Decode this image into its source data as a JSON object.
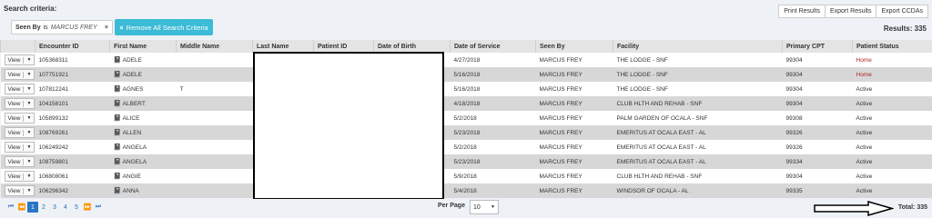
{
  "criteria": {
    "label": "Search criteria:",
    "chip": {
      "key": "Seen By",
      "op": "is",
      "value": "MARCUS FREY",
      "close": "×"
    },
    "remove_all": {
      "icon": "×",
      "label": "Remove All Search Criteria"
    }
  },
  "exports": [
    "Print Results",
    "Export Results",
    "Export CCDAs"
  ],
  "results": "Results: 335",
  "columns": [
    "",
    "Encounter ID",
    "First Name",
    "Middle Name",
    "Last Name",
    "Patient ID",
    "Date of Birth",
    "Date of Service",
    "Seen By",
    "Facility",
    "Primary CPT",
    "Patient Status"
  ],
  "view_label": "View",
  "rows": [
    {
      "id": "105368311",
      "first": "ADELE",
      "middle": "",
      "dos": "4/27/2018",
      "seen": "MARCUS FREY",
      "facility": "THE LODGE - SNF",
      "cpt": "99304",
      "status": "Home"
    },
    {
      "id": "107751921",
      "first": "ADELE",
      "middle": "",
      "dos": "5/16/2018",
      "seen": "MARCUS FREY",
      "facility": "THE LODGE - SNF",
      "cpt": "99304",
      "status": "Home"
    },
    {
      "id": "107812241",
      "first": "AGNES",
      "middle": "T",
      "dos": "5/16/2018",
      "seen": "MARCUS FREY",
      "facility": "THE LODGE - SNF",
      "cpt": "99304",
      "status": "Active"
    },
    {
      "id": "104158101",
      "first": "ALBERT",
      "middle": "",
      "dos": "4/18/2018",
      "seen": "MARCUS FREY",
      "facility": "CLUB HLTH AND REHAB - SNF",
      "cpt": "99304",
      "status": "Active"
    },
    {
      "id": "105899132",
      "first": "ALICE",
      "middle": "",
      "dos": "5/2/2018",
      "seen": "MARCUS FREY",
      "facility": "PALM GARDEN OF OCALA - SNF",
      "cpt": "99308",
      "status": "Active"
    },
    {
      "id": "108769261",
      "first": "ALLEN",
      "middle": "",
      "dos": "5/23/2018",
      "seen": "MARCUS FREY",
      "facility": "EMERITUS AT OCALA EAST - AL",
      "cpt": "99326",
      "status": "Active"
    },
    {
      "id": "106249242",
      "first": "ANGELA",
      "middle": "",
      "dos": "5/2/2018",
      "seen": "MARCUS FREY",
      "facility": "EMERITUS AT OCALA EAST - AL",
      "cpt": "99326",
      "status": "Active"
    },
    {
      "id": "108759801",
      "first": "ANGELA",
      "middle": "",
      "dos": "5/23/2018",
      "seen": "MARCUS FREY",
      "facility": "EMERITUS AT OCALA EAST - AL",
      "cpt": "99334",
      "status": "Active"
    },
    {
      "id": "106808061",
      "first": "ANGIE",
      "middle": "",
      "dos": "5/9/2018",
      "seen": "MARCUS FREY",
      "facility": "CLUB HLTH AND REHAB - SNF",
      "cpt": "99304",
      "status": "Active"
    },
    {
      "id": "106296342",
      "first": "ANNA",
      "middle": "",
      "dos": "5/4/2018",
      "seen": "MARCUS FREY",
      "facility": "WINDSOR OF OCALA - AL",
      "cpt": "99335",
      "status": "Active"
    }
  ],
  "pager": {
    "first": "⏮",
    "prev": "⏪",
    "pages": [
      "1",
      "2",
      "3",
      "4",
      "5"
    ],
    "active_page": "1",
    "next": "⏩",
    "last": "⏭"
  },
  "per_page": {
    "label": "Per Page",
    "value": "10"
  },
  "total": "Total: 335"
}
